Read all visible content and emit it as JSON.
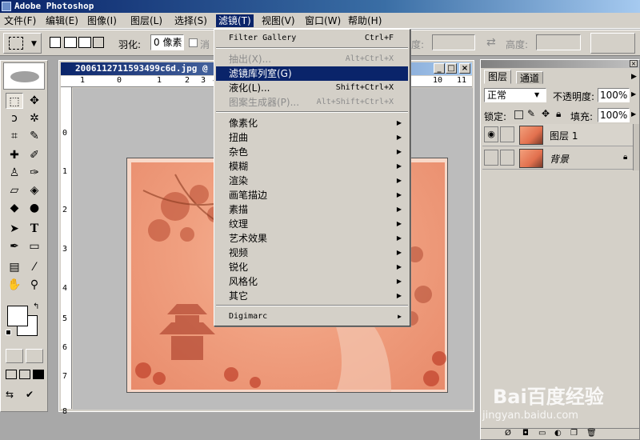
{
  "app": {
    "title": "Adobe Photoshop"
  },
  "menubar": [
    {
      "label": "文件(F)"
    },
    {
      "label": "编辑(E)"
    },
    {
      "label": "图像(I)"
    },
    {
      "label": "图层(L)"
    },
    {
      "label": "选择(S)"
    },
    {
      "label": "滤镜(T)"
    },
    {
      "label": "视图(V)"
    },
    {
      "label": "窗口(W)"
    },
    {
      "label": "帮助(H)"
    }
  ],
  "options": {
    "feather_label": "羽化:",
    "feather_value": "0 像素",
    "antialias_label": "消",
    "height_label_partial": "度:",
    "height_label": "高度:"
  },
  "document": {
    "title": "20061127115934​99c6d.jpg @",
    "ruler_h": [
      "1",
      "0",
      "1",
      "2",
      "3",
      "4",
      "10",
      "11"
    ],
    "ruler_v": [
      "0",
      "1",
      "2",
      "3",
      "4",
      "5",
      "6",
      "7",
      "8"
    ]
  },
  "filter_menu": {
    "gallery": {
      "label": "Filter Gallery",
      "shortcut": "Ctrl+F"
    },
    "extract": {
      "label": "抽出(X)...",
      "shortcut": "Alt+Ctrl+X"
    },
    "filter_gallery_cn": {
      "label": "滤镜库列室(G)",
      "shortcut": ""
    },
    "liquify": {
      "label": "液化(L)...",
      "shortcut": "Shift+Ctrl+X"
    },
    "pattern": {
      "label": "图案生成器(P)...",
      "shortcut": "Alt+Shift+Ctrl+X"
    },
    "submenus": [
      "像素化",
      "扭曲",
      "杂色",
      "模糊",
      "渲染",
      "画笔描边",
      "素描",
      "纹理",
      "艺术效果",
      "视频",
      "锐化",
      "风格化",
      "其它"
    ],
    "digimarc": "Digimarc"
  },
  "layers_panel": {
    "tabs": [
      "图层",
      "通道"
    ],
    "blend_mode": "正常",
    "opacity_label": "不透明度:",
    "opacity_value": "100%",
    "lock_label": "锁定:",
    "fill_label": "填充:",
    "fill_value": "100%",
    "layers": [
      {
        "name": "图层 1",
        "visible": true
      },
      {
        "name": "背景",
        "visible": false
      }
    ]
  },
  "watermark": {
    "brand": "Bai百度经验",
    "url": "jingyan.baidu.com"
  }
}
